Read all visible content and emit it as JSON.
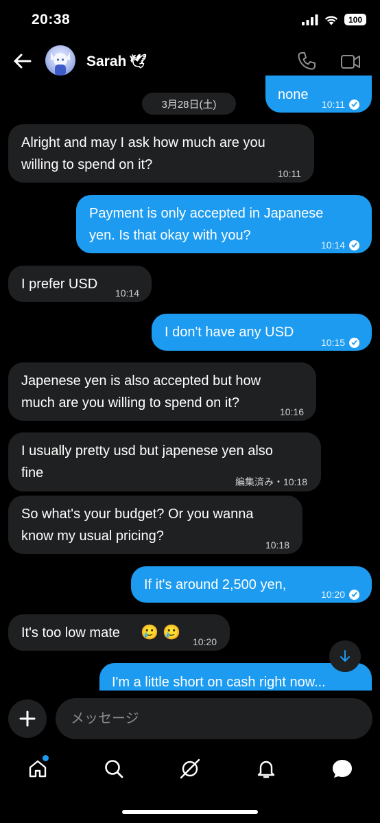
{
  "status_bar": {
    "time": "20:38",
    "battery": "100"
  },
  "header": {
    "contact_name": "Sarah",
    "contact_emoji": "🕊"
  },
  "date_separator": "3月28日(土)",
  "messages": [
    {
      "dir": "out",
      "text": "none",
      "time": "10:11",
      "read": true
    },
    {
      "dir": "in",
      "lines": [
        "Alright and may I ask how much are you",
        "willing to spend on it?"
      ],
      "time": "10:11"
    },
    {
      "dir": "out",
      "lines": [
        "Payment is only accepted in Japanese",
        "yen. Is that okay with you?"
      ],
      "time": "10:14",
      "read": true
    },
    {
      "dir": "in",
      "text": "I prefer USD",
      "time": "10:14"
    },
    {
      "dir": "out",
      "text": "I don't have any USD",
      "time": "10:15",
      "read": true
    },
    {
      "dir": "in",
      "lines": [
        "Japenese yen is also accepted but how",
        "much are you willing to spend on it?"
      ],
      "time": "10:16"
    },
    {
      "dir": "in",
      "lines": [
        "I usually pretty usd but japenese yen also",
        "fine"
      ],
      "time": "10:18",
      "edited": "編集済み・"
    },
    {
      "dir": "in",
      "lines": [
        "So what's your budget? Or you wanna",
        "know my usual pricing?"
      ],
      "time": "10:18"
    },
    {
      "dir": "out",
      "text": "If it's around 2,500 yen,",
      "time": "10:20",
      "read": true
    },
    {
      "dir": "in",
      "text": "It's too low mate",
      "emoji": "🥲 🥲",
      "time": "10:20"
    },
    {
      "dir": "out",
      "text": "I'm a little short on cash right now...",
      "partial": true
    }
  ],
  "composer": {
    "placeholder": "メッセージ"
  },
  "nav": {
    "items": [
      "home-icon",
      "search-icon",
      "explore-icon",
      "notifications-icon",
      "messages-icon"
    ],
    "home_has_badge": true
  },
  "colors": {
    "accent": "#1d9bf0",
    "incoming_bubble": "#1f2022",
    "background": "#000000"
  }
}
